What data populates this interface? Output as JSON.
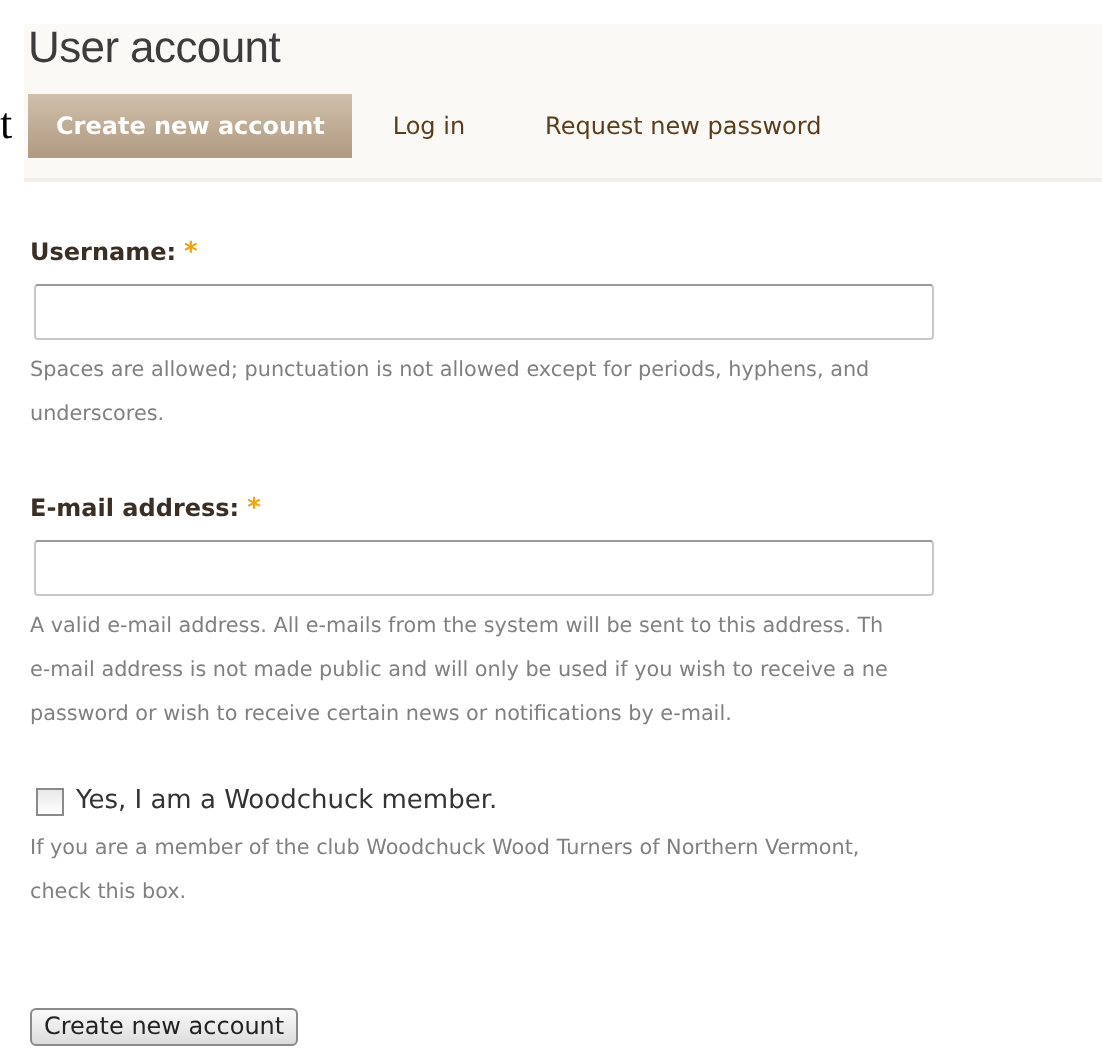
{
  "edge_fragment": "t",
  "page_title": "User account",
  "tabs": [
    {
      "label": "Create new account",
      "selected": true
    },
    {
      "label": "Log in",
      "selected": false
    },
    {
      "label": "Request new password",
      "selected": false
    }
  ],
  "fields": [
    {
      "kind": "text",
      "label": "Username:",
      "required_mark": "*",
      "description": "Spaces are allowed; punctuation is not allowed except for periods, hyphens, and\nunderscores."
    },
    {
      "kind": "text",
      "label": "E-mail address:",
      "required_mark": "*",
      "description": "A valid e-mail address. All e-mails from the system will be sent to this address. Th\ne-mail address is not made public and will only be used if you wish to receive a ne\npassword or wish to receive certain news or notifications by e-mail."
    },
    {
      "kind": "checkbox",
      "label": "Yes, I am a Woodchuck member.",
      "checked": false,
      "description": "If you are a member of the club Woodchuck Wood Turners of Northern Vermont,\ncheck this box."
    }
  ],
  "submit_button": "Create new account"
}
